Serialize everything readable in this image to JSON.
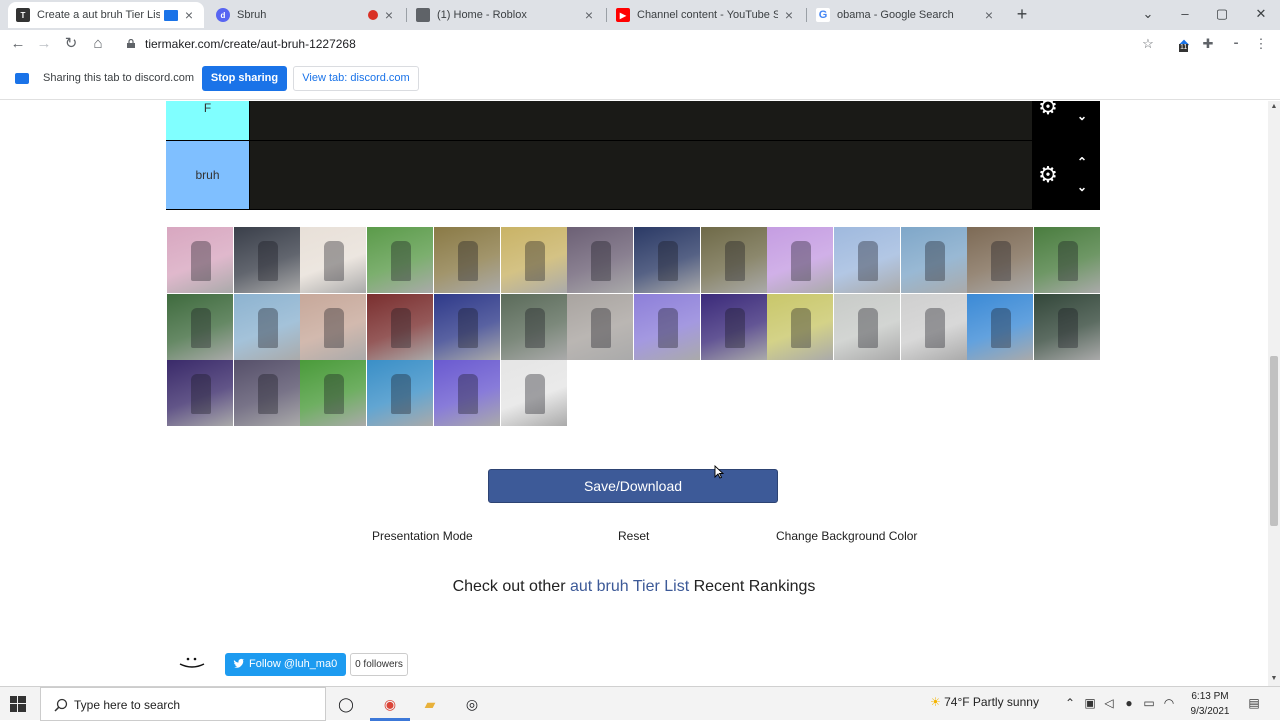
{
  "browser": {
    "tabs": [
      {
        "title": "Create a aut bruh Tier List -",
        "active": true
      },
      {
        "title": "Sbruh",
        "active": false
      },
      {
        "title": "(1) Home - Roblox",
        "active": false
      },
      {
        "title": "Channel content - YouTube Stud",
        "active": false
      },
      {
        "title": "obama - Google Search",
        "active": false
      }
    ],
    "new_tab": "+",
    "url": "tiermaker.com/create/aut-bruh-1227268",
    "extension_badge": "11"
  },
  "sharing": {
    "message": "Sharing this tab to discord.com",
    "stop_label": "Stop sharing",
    "view_label": "View tab: discord.com"
  },
  "tiers": [
    {
      "label": "F",
      "color": "#80ffff"
    },
    {
      "label": "bruh",
      "color": "#7fbfff"
    }
  ],
  "item_pool": [
    {
      "name": "pink-dress-character",
      "color": "#d8a7c0"
    },
    {
      "name": "obama-portrait",
      "color": "#3a3f4a"
    },
    {
      "name": "cartoon-character",
      "color": "#e8e0d8"
    },
    {
      "name": "roblox-avatar-green",
      "color": "#5b9b4a"
    },
    {
      "name": "golden-stand",
      "color": "#8a7a46"
    },
    {
      "name": "golden-stand-2",
      "color": "#c9b366"
    },
    {
      "name": "purple-glow-avatar",
      "color": "#6c6075"
    },
    {
      "name": "blue-glow-avatar",
      "color": "#2b3a66"
    },
    {
      "name": "roblox-avatar-gold",
      "color": "#6f6a48"
    },
    {
      "name": "pink-purple-avatar",
      "color": "#c59de2"
    },
    {
      "name": "red-pink-avatar",
      "color": "#9fb9de"
    },
    {
      "name": "blue-uniform-avatar",
      "color": "#7fa7c9"
    },
    {
      "name": "dark-avatar",
      "color": "#7d6a55"
    },
    {
      "name": "red-green-avatar",
      "color": "#4a7d3f"
    },
    {
      "name": "goku-avatar",
      "color": "#3f6b3e"
    },
    {
      "name": "black-box-avatar",
      "color": "#8db3d0"
    },
    {
      "name": "face-portrait",
      "color": "#c7a89a"
    },
    {
      "name": "red-dark-avatar",
      "color": "#7a2f2f"
    },
    {
      "name": "purple-blue-avatar",
      "color": "#2f3a8a"
    },
    {
      "name": "grey-green-avatar",
      "color": "#5b6b5a"
    },
    {
      "name": "white-grey-avatar",
      "color": "#a9a4a0"
    },
    {
      "name": "purple-face-avatar",
      "color": "#8d7fd9"
    },
    {
      "name": "purple-aura-avatar",
      "color": "#3b2a7a"
    },
    {
      "name": "blue-white-avatar",
      "color": "#c9c76a"
    },
    {
      "name": "grey-statue-avatar",
      "color": "#c8cbc8"
    },
    {
      "name": "white-car-avatar",
      "color": "#cfcfcf"
    },
    {
      "name": "blue-energy-avatar",
      "color": "#3b8ad6"
    },
    {
      "name": "dark-green-avatar",
      "color": "#33473a"
    },
    {
      "name": "magenta-glow-avatar",
      "color": "#3a2a6a"
    },
    {
      "name": "grey-purple-avatar",
      "color": "#56506a"
    },
    {
      "name": "green-dark-avatar",
      "color": "#4a9b3a"
    },
    {
      "name": "blue-green-avatar",
      "color": "#3a8fc7"
    },
    {
      "name": "purple-stand-avatar",
      "color": "#6a5ad0"
    },
    {
      "name": "black-white-avatar",
      "color": "#e5e5e5"
    }
  ],
  "actions": {
    "save": "Save/Download",
    "presentation": "Presentation Mode",
    "reset": "Reset",
    "background": "Change Background Color"
  },
  "rankings": {
    "prefix": "Check out other ",
    "highlight": "aut bruh Tier List",
    "suffix": " Recent Rankings"
  },
  "social": {
    "follow": "Follow @luh_ma0",
    "followers": "0 followers"
  },
  "taskbar": {
    "search_placeholder": "Type here to search",
    "weather": "74°F  Partly sunny",
    "time": "6:13 PM",
    "date": "9/3/2021"
  },
  "colors": {
    "accent": "#1a73e8",
    "save_button": "#3d5a98",
    "tier_bg": "#1a1a17",
    "highlight_link": "#3d5a98"
  }
}
